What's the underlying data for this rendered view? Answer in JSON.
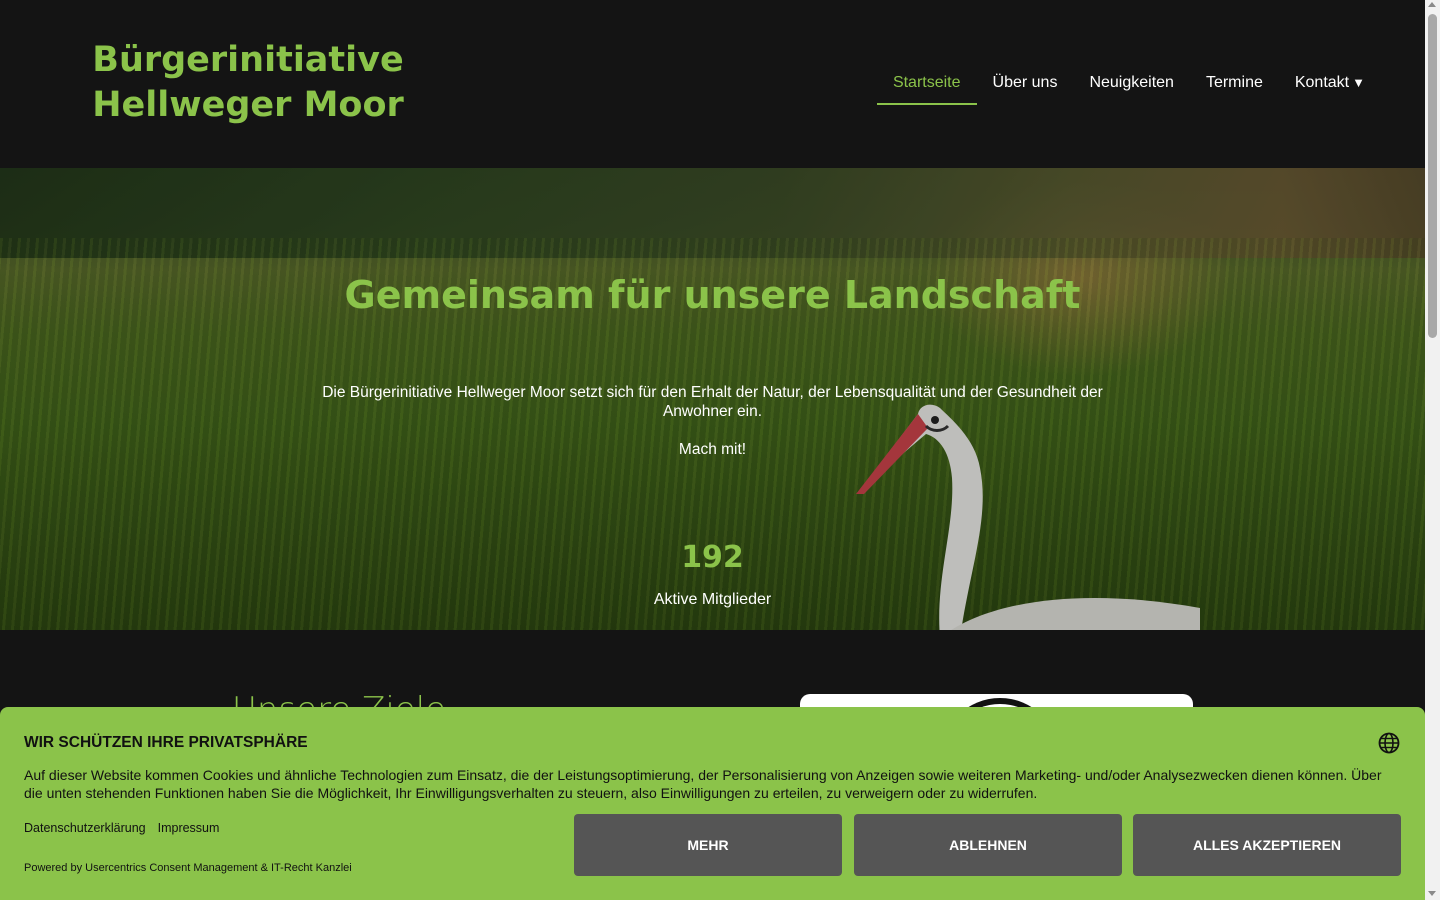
{
  "header": {
    "logo_line1": "Bürgerinitiative",
    "logo_line2": "Hellweger Moor"
  },
  "nav": {
    "items": [
      {
        "label": "Startseite",
        "active": true
      },
      {
        "label": "Über uns"
      },
      {
        "label": "Neuigkeiten"
      },
      {
        "label": "Termine"
      },
      {
        "label": "Kontakt",
        "has_dropdown": true
      }
    ],
    "caret": "▼"
  },
  "hero": {
    "title": "Gemeinsam für unsere Landschaft",
    "text": "Die Bürgerinitiative Hellweger Moor setzt sich für den Erhalt der Natur, der Lebensqualität und der Gesundheit der Anwohner ein.",
    "cta": "Mach mit!",
    "counter_value": "192",
    "counter_label": "Aktive Mitglieder"
  },
  "section": {
    "title": "Unsere Ziele"
  },
  "consent": {
    "title": "WIR SCHÜTZEN IHRE PRIVATSPHÄRE",
    "text": "Auf dieser Website kommen Cookies und ähnliche Technologien zum Einsatz, die der Leistungsoptimierung, der Personalisierung von Anzeigen sowie weiteren Marketing- und/oder Analysezwecken dienen können. Über die unten stehenden Funktionen haben Sie die Möglichkeit, Ihr Einwilligungsverhalten zu steuern, also Einwilligungen zu erteilen, zu verweigern oder zu widerrufen.",
    "link_privacy": "Datenschutzerklärung",
    "link_imprint": "Impressum",
    "powered_by": "Powered by Usercentrics Consent Management & IT-Recht Kanzlei",
    "btn_more": "MEHR",
    "btn_decline": "ABLEHNEN",
    "btn_accept": "ALLES AKZEPTIEREN"
  },
  "colors": {
    "accent": "#8bc34a",
    "header_bg": "#141414",
    "button_bg": "#555555"
  },
  "icons": {
    "language": "globe-icon",
    "dropdown": "caret-down-icon"
  }
}
